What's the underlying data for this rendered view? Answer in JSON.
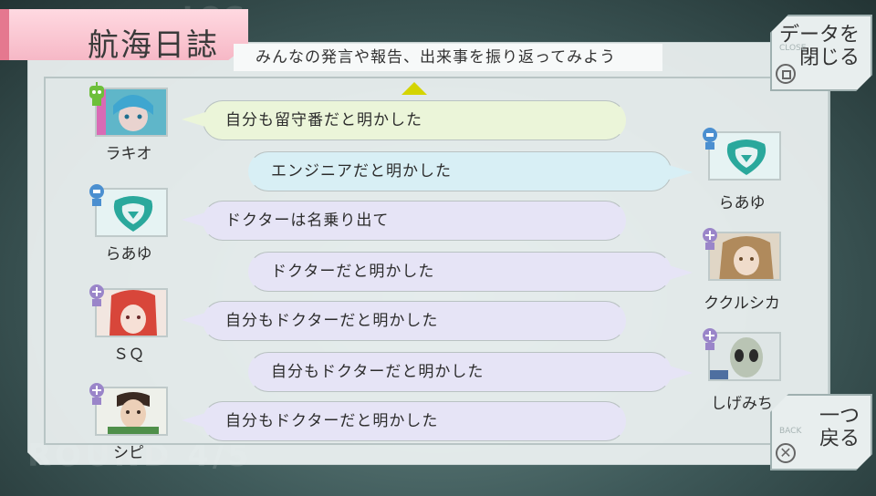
{
  "header": {
    "title": "航海日誌",
    "bg_label": "LOG"
  },
  "subtitle": "みんなの発言や報告、出来事を振り返ってみよう",
  "buttons": {
    "close": {
      "label": "データを\n閉じる"
    },
    "back": {
      "label": "一つ\n戻る",
      "small": "BACK"
    },
    "close_small": "CLOSE"
  },
  "bg_round": "ROUND 4/5",
  "colors": {
    "title_tab": "#f6b8c6",
    "bubble_green": "#ebf5d9",
    "bubble_blue": "#d8eff5",
    "bubble_lavender": "#e6e4f6",
    "role_engineer": "#4b8fd0",
    "role_green": "#6dbf3a",
    "role_doctor": "#9a85c9",
    "arrow": "#d4d400"
  },
  "entries": [
    {
      "side": "left",
      "speaker": "ラキオ",
      "role_icon": "green-robot-icon",
      "text": "自分も留守番だと明かした",
      "color": "green"
    },
    {
      "side": "right",
      "speaker": "らあゆ",
      "role_icon": "engineer-icon",
      "text": "エンジニアだと明かした",
      "color": "blue"
    },
    {
      "side": "left",
      "speaker": "らあゆ",
      "role_icon": "engineer-icon",
      "text": "ドクターは名乗り出て",
      "color": "lavender"
    },
    {
      "side": "right",
      "speaker": "ククルシカ",
      "role_icon": "doctor-icon",
      "text": "ドクターだと明かした",
      "color": "lavender"
    },
    {
      "side": "left",
      "speaker": "ＳＱ",
      "role_icon": "doctor-icon",
      "text": "自分もドクターだと明かした",
      "color": "lavender"
    },
    {
      "side": "right",
      "speaker": "しげみち",
      "role_icon": "doctor-icon",
      "text": "自分もドクターだと明かした",
      "color": "lavender"
    },
    {
      "side": "left",
      "speaker": "シピ",
      "role_icon": "doctor-icon",
      "text": "自分もドクターだと明かした",
      "color": "lavender"
    }
  ]
}
